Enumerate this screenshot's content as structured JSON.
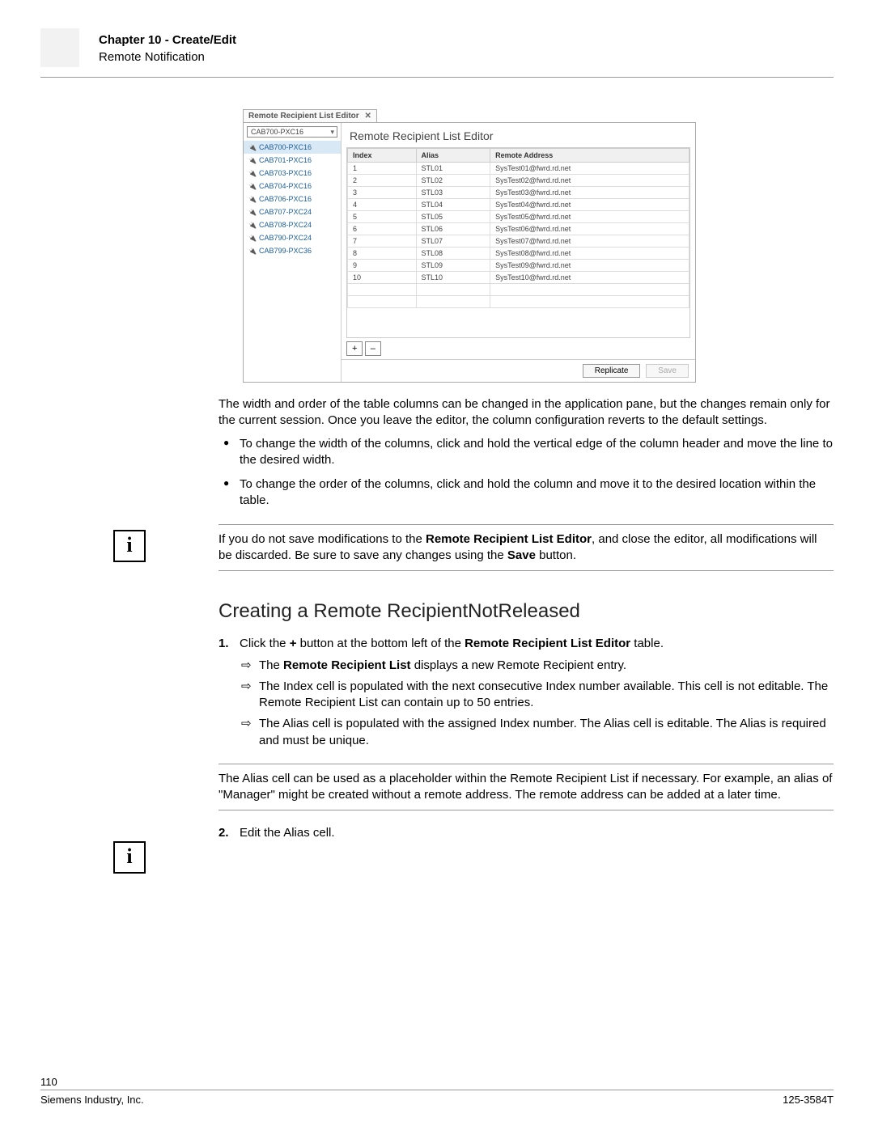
{
  "header": {
    "chapter": "Chapter 10 - Create/Edit",
    "section": "Remote Notification"
  },
  "ui": {
    "tab_title": "Remote Recipient List Editor",
    "combo": "CAB700-PXC16",
    "selected_idx": 0,
    "side_items": [
      "CAB700-PXC16",
      "CAB701-PXC16",
      "CAB703-PXC16",
      "CAB704-PXC16",
      "CAB706-PXC16",
      "CAB707-PXC24",
      "CAB708-PXC24",
      "CAB790-PXC24",
      "CAB799-PXC36"
    ],
    "main_title": "Remote Recipient List Editor",
    "cols": [
      "Index",
      "Alias",
      "Remote Address"
    ],
    "rows": [
      [
        "1",
        "STL01",
        "SysTest01@fwrd.rd.net"
      ],
      [
        "2",
        "STL02",
        "SysTest02@fwrd.rd.net"
      ],
      [
        "3",
        "STL03",
        "SysTest03@fwrd.rd.net"
      ],
      [
        "4",
        "STL04",
        "SysTest04@fwrd.rd.net"
      ],
      [
        "5",
        "STL05",
        "SysTest05@fwrd.rd.net"
      ],
      [
        "6",
        "STL06",
        "SysTest06@fwrd.rd.net"
      ],
      [
        "7",
        "STL07",
        "SysTest07@fwrd.rd.net"
      ],
      [
        "8",
        "STL08",
        "SysTest08@fwrd.rd.net"
      ],
      [
        "9",
        "STL09",
        "SysTest09@fwrd.rd.net"
      ],
      [
        "10",
        "STL10",
        "SysTest10@fwrd.rd.net"
      ]
    ],
    "add_label": "+",
    "remove_label": "–",
    "replicate": "Replicate",
    "save": "Save"
  },
  "body": {
    "p1": "The width and order of the table columns can be changed in the application pane, but the changes remain only for the current session. Once you leave the editor, the column configuration reverts to the default settings.",
    "b1": "To change the width of the columns, click and hold the vertical edge of the column header and move the line to the desired width.",
    "b2": "To change the order of the columns, click and hold the column and move it to the desired location within the table.",
    "note1_a": "If you do not save modifications to the ",
    "note1_strong": "Remote Recipient List Editor",
    "note1_b": ", and close the editor, all modifications will be discarded. Be sure to save any changes using the ",
    "note1_save": "Save",
    "note1_c": " button.",
    "h2": "Creating a Remote RecipientNotReleased",
    "s1_a": "Click the ",
    "s1_plus": "+",
    "s1_b": " button at the bottom left of the ",
    "s1_strong": "Remote Recipient List Editor",
    "s1_c": " table.",
    "s1_r1_a": "The ",
    "s1_r1_strong": "Remote Recipient List",
    "s1_r1_b": " displays a new Remote Recipient entry.",
    "s1_r2": "The Index cell is populated with the next consecutive Index number available. This cell is not editable. The Remote Recipient List can contain up to 50 entries.",
    "s1_r3": "The Alias cell is populated with the assigned Index number. The Alias cell is editable. The Alias is required and must be unique.",
    "note2": "The Alias cell can be used as a placeholder within the Remote Recipient List if necessary. For example, an alias of \"Manager\" might be created without a remote address. The remote address can be added at a later time.",
    "s2": "Edit the Alias cell."
  },
  "footer": {
    "page": "110",
    "left": "Siemens Industry, Inc.",
    "right": "125-3584T"
  }
}
